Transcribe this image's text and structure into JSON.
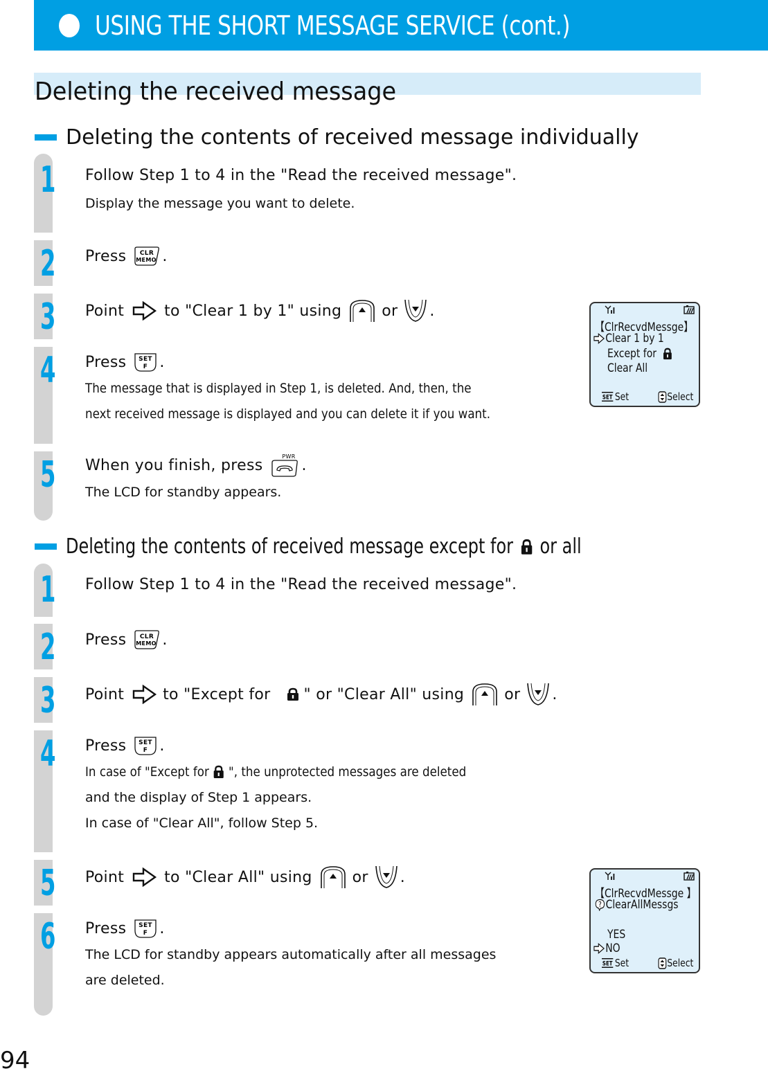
{
  "header": {
    "title": "USING THE SHORT MESSAGE SERVICE (cont.)",
    "bullet_icon": "filled-circle-icon"
  },
  "section": {
    "title": "Deleting the received message"
  },
  "colors": {
    "accent": "#009fe3",
    "title_band": "#d6ecf9",
    "rail": "#d3d3d3",
    "lcd_background": "#dff0fa"
  },
  "part1": {
    "heading": "Deleting the contents of received message individually",
    "steps": [
      {
        "number": "1",
        "main": "Follow Step 1 to 4 in the \"Read the received message\".",
        "notes": [
          "Display the message you want to delete."
        ]
      },
      {
        "number": "2",
        "main_prefix": "Press",
        "key": "CLR/MEMO",
        "main_suffix": "."
      },
      {
        "number": "3",
        "main_prefix": "Point",
        "pointer_icon": "pointer-arrow-icon",
        "main_middle": "to \"Clear 1 by 1\" using",
        "key_up": "up-key",
        "or_text": "or",
        "key_down": "down-key",
        "main_suffix": "."
      },
      {
        "number": "4",
        "main_prefix": "Press",
        "key": "SET/F",
        "main_suffix": ".",
        "notes": [
          "The message that is displayed in Step 1, is deleted. And, then, the",
          "next received message is displayed and you can delete it if you want."
        ]
      },
      {
        "number": "5",
        "main_prefix": "When you finish, press",
        "key": "PWR",
        "main_suffix": ".",
        "notes": [
          "The LCD for standby appears."
        ]
      }
    ],
    "lcd": {
      "title": "【ClrRecvdMessge】",
      "items": [
        "Clear 1 by 1",
        "Except for",
        "Clear All"
      ],
      "selected_index": 0,
      "softkey_left": "Set",
      "softkey_right": "Select",
      "set_label": "SET"
    }
  },
  "part2": {
    "heading_prefix": "Deleting the contents of received message except for",
    "heading_suffix": "or all",
    "steps": [
      {
        "number": "1",
        "main": "Follow Step 1 to 4 in the \"Read the received message\"."
      },
      {
        "number": "2",
        "main_prefix": "Press",
        "key": "CLR/MEMO",
        "main_suffix": "."
      },
      {
        "number": "3",
        "main_prefix": "Point",
        "main_middle_a": "to \"Except for",
        "main_middle_b": "\" or \"Clear All\" using",
        "or_text": "or",
        "main_suffix": "."
      },
      {
        "number": "4",
        "main_prefix": "Press",
        "key": "SET/F",
        "main_suffix": ".",
        "note1_prefix": "In case of \"Except for",
        "note1_suffix": "\", the unprotected messages are deleted",
        "notes": [
          "and the display of Step 1 appears.",
          "In case of \"Clear All\", follow Step 5."
        ]
      },
      {
        "number": "5",
        "main_prefix": "Point",
        "main_middle": "to \"Clear All\" using",
        "or_text": "or",
        "main_suffix": "."
      },
      {
        "number": "6",
        "main_prefix": "Press",
        "key": "SET/F",
        "main_suffix": ".",
        "notes": [
          "The LCD for standby appears automatically after all messages",
          "are deleted."
        ]
      }
    ],
    "lcd": {
      "title": "【ClrRecvdMessge 】",
      "question": "ClearAllMessgs",
      "options": [
        "YES",
        "NO"
      ],
      "selected_index": 1,
      "softkey_left": "Set",
      "softkey_right": "Select",
      "set_label": "SET"
    }
  },
  "keys": {
    "clr_top": "CLR",
    "clr_bottom": "MEMO",
    "set_top": "SET",
    "set_bottom": "F",
    "pwr_label": "PWR"
  },
  "page_number": "94"
}
